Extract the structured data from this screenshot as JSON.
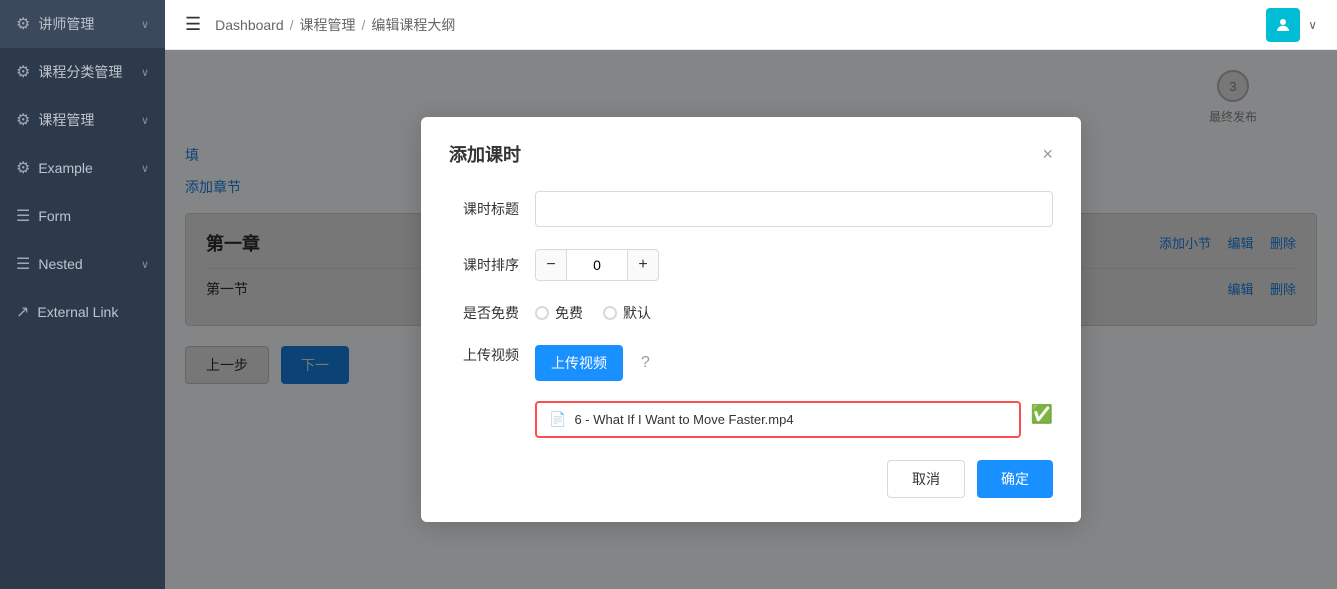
{
  "sidebar": {
    "items": [
      {
        "id": "teacher",
        "label": "讲师管理",
        "icon": "⚙",
        "hasArrow": true
      },
      {
        "id": "course-category",
        "label": "课程分类管理",
        "icon": "⚙",
        "hasArrow": true
      },
      {
        "id": "course-manage",
        "label": "课程管理",
        "icon": "⚙",
        "hasArrow": true
      },
      {
        "id": "example",
        "label": "Example",
        "icon": "⚙",
        "hasArrow": true
      },
      {
        "id": "form",
        "label": "Form",
        "icon": "☰",
        "hasArrow": false
      },
      {
        "id": "nested",
        "label": "Nested",
        "icon": "☰",
        "hasArrow": true
      },
      {
        "id": "external-link",
        "label": "External Link",
        "icon": "↗",
        "hasArrow": false
      }
    ]
  },
  "header": {
    "menu_icon": "☰",
    "breadcrumb": {
      "home": "Dashboard",
      "sep1": "/",
      "middle": "课程管理",
      "sep2": "/",
      "current": "编辑课程大纲"
    },
    "avatar_text": "👤"
  },
  "page": {
    "step3_label": "最终发布",
    "step3_num": "3",
    "fill_info_text": "填",
    "add_chapter_label": "添加章节",
    "chapter_title": "第一章",
    "chapter_actions": {
      "add_section": "添加小节",
      "edit": "编辑",
      "delete": "删除"
    },
    "section_name": "第一节",
    "section_actions": {
      "edit": "编辑",
      "delete": "删除"
    },
    "prev_btn": "上一步",
    "next_btn": "下一"
  },
  "modal": {
    "title": "添加课时",
    "close_label": "×",
    "fields": {
      "title_label": "课时标题",
      "title_placeholder": "",
      "order_label": "课时排序",
      "order_value": "0",
      "free_label": "是否免费",
      "free_option": "免费",
      "default_option": "默认",
      "upload_label": "上传视频",
      "upload_btn": "上传视频",
      "upload_help": "?",
      "file_name": "6 - What If I Want to Move Faster.mp4"
    },
    "cancel_btn": "取消",
    "confirm_btn": "确定"
  }
}
